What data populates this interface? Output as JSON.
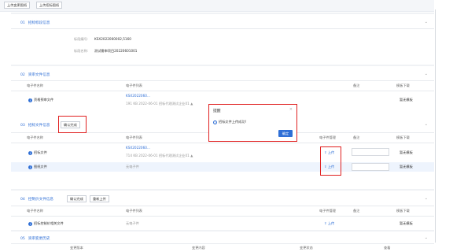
{
  "toolbar": {
    "btn1": "上传变更图纸",
    "btn2": "上传招标图纸"
  },
  "project": {
    "title_num": "01",
    "title": "招标标段信息",
    "code_label": "标段编号:",
    "code_value": "KSX2022060002,5160",
    "name_label": "标段名称:",
    "name_value": "测试需审项目20220601001"
  },
  "reference": {
    "title_num": "02",
    "title": "资审文件信息",
    "headers": {
      "name": "电子件名称",
      "list": "电子件列表",
      "remark": "备注",
      "download": "模板下载"
    },
    "row": {
      "name": "资格预审文件",
      "file": "KSX2022060...",
      "meta": "191 KB 2022-06-01 招标代理测试企业01",
      "flag": "▲",
      "tpl": "暂无模板"
    }
  },
  "bid": {
    "title_num": "03",
    "title": "招标文件信息",
    "confirm_btn": "确认完成",
    "headers": {
      "name": "电子件名称",
      "list": "电子件列表",
      "manage": "电子件管理",
      "remark": "备注",
      "download": "模板下载"
    },
    "rows": [
      {
        "name": "招标文件",
        "file": "KSX2022060...",
        "meta": "714 KB 2022-06-01 招标代理测试企业01",
        "flag": "▲",
        "upload": "上传",
        "tpl": "暂无模板"
      },
      {
        "name": "图纸文件",
        "file": "",
        "meta": "无电子件",
        "flag": "",
        "upload": "上传",
        "tpl": "暂无模板"
      }
    ]
  },
  "control": {
    "title_num": "04",
    "title": "控制价文件信息",
    "confirm_btn": "确认完成",
    "reupload_btn": "重新上传",
    "headers": {
      "name": "电子件名称",
      "list": "电子件列表",
      "manage": "电子件管理",
      "remark": "备注",
      "download": "模板下载"
    },
    "row": {
      "name": "招标控制价相关文件",
      "meta": "无电子件",
      "upload": "上传",
      "tpl": "暂无模板"
    }
  },
  "history": {
    "title_num": "05",
    "title": "资审变更历史",
    "headers": {
      "c1": "变更版本",
      "c2": "变更内容",
      "c3": "变更状态",
      "c4": "查看"
    }
  },
  "modal": {
    "title": "提醒",
    "close": "×",
    "icon": "i",
    "message": "招标文件上传成功!",
    "ok": "确定"
  },
  "icons": {
    "upload": "⇪",
    "chevron": "⌄",
    "info_dot": "i"
  },
  "colors": {
    "accent": "#2f6fd6",
    "highlight": "#e02020"
  }
}
